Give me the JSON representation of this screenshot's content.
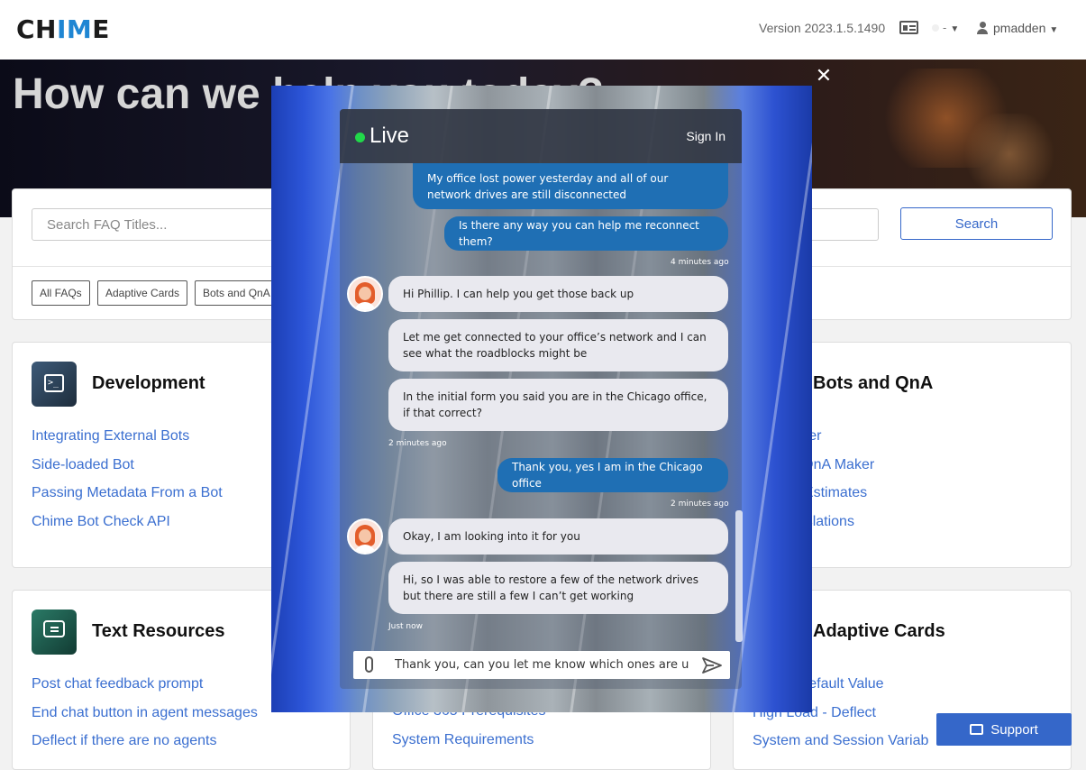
{
  "header": {
    "logo_prefix": "CH",
    "logo_accent": "IM",
    "logo_suffix": "E",
    "version": "Version 2023.1.5.1490",
    "language": "-",
    "username": "pmadden"
  },
  "hero": {
    "title": "How can we help you today?"
  },
  "search": {
    "placeholder": "Search FAQ Titles...",
    "button": "Search",
    "chips": [
      "All FAQs",
      "Adaptive Cards",
      "Bots and QnA"
    ]
  },
  "categories": [
    {
      "title": "Development",
      "links": [
        "Integrating External Bots",
        "Side-loaded Bot",
        "Passing Metadata From a Bot",
        "Chime Bot Check API"
      ]
    },
    {
      "title": "Bots and QnA",
      "links": [
        "QnAMaker",
        "ng with QnA Maker",
        "ntiment Estimates",
        "ent Translations"
      ]
    },
    {
      "title": "Text Resources",
      "links": [
        "Post chat feedback prompt",
        "End chat button in agent messages",
        "Deflect if there are no agents"
      ]
    },
    {
      "title": "",
      "links": [
        "Office 365 Prerequisites",
        "System Requirements"
      ]
    },
    {
      "title": "Adaptive Cards",
      "links": [
        "Rating Default Value",
        "High Load - Deflect",
        "System and Session Variab"
      ]
    }
  ],
  "support": {
    "label": "Support"
  },
  "chat": {
    "status": "Live",
    "sign_in": "Sign In",
    "messages": [
      {
        "from": "user",
        "text": "My office lost power yesterday and all of our network drives are still disconnected"
      },
      {
        "from": "user",
        "text": "Is there any way you can help me reconnect them?"
      },
      {
        "from": "agent",
        "text": "Hi Phillip. I can help you get those back up"
      },
      {
        "from": "agent",
        "text": "Let me get connected to your office’s network and I can see what the roadblocks might be"
      },
      {
        "from": "agent",
        "text": "In the initial form you said you are in the Chicago office, if that correct?"
      },
      {
        "from": "user",
        "text": "Thank you, yes I am in the Chicago office"
      },
      {
        "from": "agent",
        "text": "Okay, I am looking into it for you"
      },
      {
        "from": "agent",
        "text": "Hi, so I was able to restore a few of the network drives but there are still a few I can’t get working"
      }
    ],
    "timestamps": [
      "4 minutes ago",
      "2 minutes ago",
      "2 minutes ago",
      "Just now"
    ],
    "composer_text": "Thank you, can you let me know which ones are up?"
  }
}
